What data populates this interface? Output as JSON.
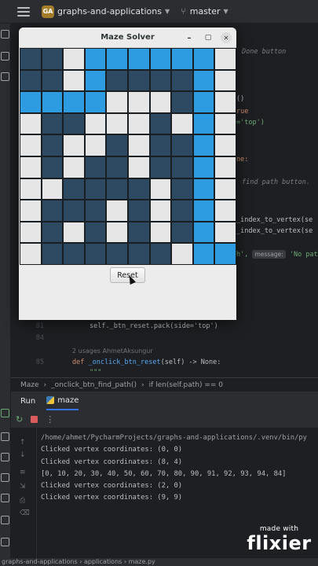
{
  "ide": {
    "project_badge": "GA",
    "project_name": "graphs-and-applications",
    "branch": "master"
  },
  "editor": {
    "fragments": {
      "done_button": "Done button",
      "paren_call": "()",
      "true_kw": "rue",
      "side_top": "='top')",
      "none_colon": "ne:",
      "find_path_comment": "find path button.",
      "index_to_vertex_1": "_index_to_vertex(se",
      "index_to_vertex_2": "_index_to_vertex(se",
      "messagebox_prefix": "h',",
      "message_hint": "message:",
      "no_path": "'No pat"
    },
    "line_81_number": "81",
    "line_81_text": "self._btn_reset.pack(side='top')",
    "line_84_number": "84",
    "usages": "2 usages",
    "author": "AhmetAksungur",
    "line_85_number": "85",
    "line_85_def": "def ",
    "line_85_fn": "_onclick_btn_reset",
    "line_85_rest": "(self) -> None:",
    "line_86_text": "\"\"\""
  },
  "breadcrumb": [
    "Maze",
    "_onclick_btn_find_path()",
    "if len(self.path) == 0"
  ],
  "run_panel": {
    "run_label": "Run",
    "tab_label": "maze",
    "console_lines": [
      "/home/ahmet/PycharmProjects/graphs-and-applications/.venv/bin/py",
      "Clicked vertex coordinates: (0, 0)",
      "Clicked vertex coordinates: (8, 4)",
      "[0, 10, 20, 30, 40, 50, 60, 70, 80, 90, 91, 92, 93, 94, 84]",
      "Clicked vertex coordinates: (2, 0)",
      "Clicked vertex coordinates: (9, 9)"
    ]
  },
  "status_bar": {
    "items": [
      "graphs-and-applications",
      "applications",
      "maze.py"
    ]
  },
  "maze_window": {
    "title": "Maze Solver",
    "minimize_glyph": "–",
    "maximize_glyph": "▢",
    "close_glyph": "✕",
    "reset_label": "Reset",
    "grid_rows": [
      [
        "d",
        "d",
        "w",
        "b",
        "b",
        "b",
        "b",
        "b",
        "b",
        "w"
      ],
      [
        "d",
        "d",
        "w",
        "b",
        "d",
        "d",
        "d",
        "d",
        "b",
        "w"
      ],
      [
        "b",
        "b",
        "b",
        "b",
        "w",
        "w",
        "w",
        "d",
        "b",
        "w"
      ],
      [
        "w",
        "d",
        "d",
        "w",
        "w",
        "w",
        "d",
        "w",
        "b",
        "w"
      ],
      [
        "w",
        "d",
        "w",
        "w",
        "d",
        "w",
        "d",
        "d",
        "b",
        "w"
      ],
      [
        "w",
        "d",
        "w",
        "d",
        "d",
        "w",
        "d",
        "d",
        "b",
        "w"
      ],
      [
        "w",
        "w",
        "d",
        "d",
        "d",
        "d",
        "w",
        "d",
        "b",
        "w"
      ],
      [
        "w",
        "d",
        "d",
        "d",
        "w",
        "d",
        "w",
        "d",
        "b",
        "w"
      ],
      [
        "w",
        "d",
        "w",
        "d",
        "w",
        "d",
        "w",
        "d",
        "b",
        "w"
      ],
      [
        "w",
        "d",
        "d",
        "d",
        "d",
        "d",
        "d",
        "w",
        "b",
        "b"
      ]
    ],
    "colors": {
      "wall": "#2e4a63",
      "open": "#e6e6e6",
      "path": "#2d9ce0"
    }
  },
  "watermark": {
    "made_with": "made with",
    "brand": "flixier"
  }
}
